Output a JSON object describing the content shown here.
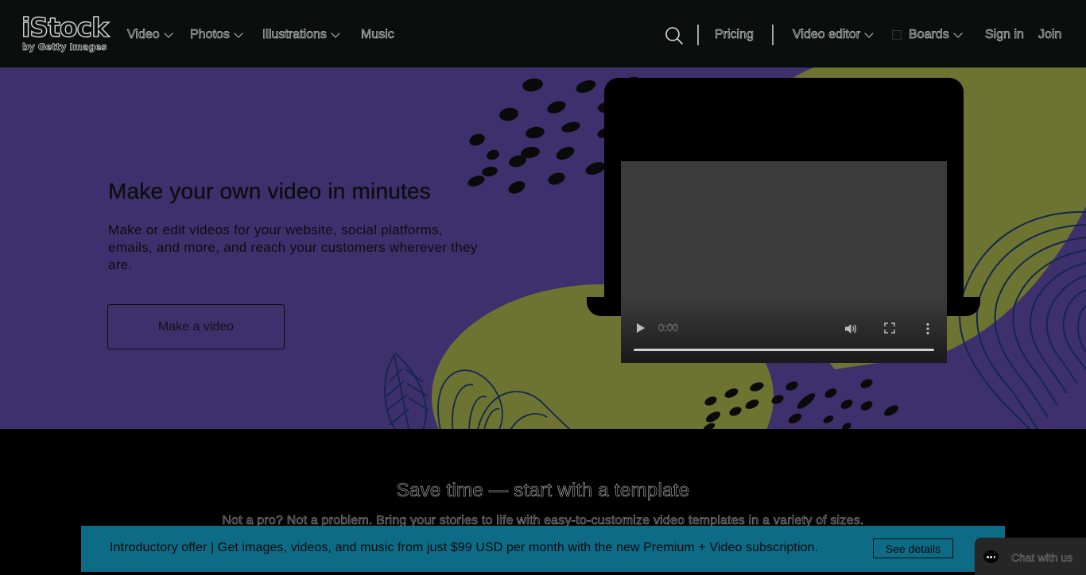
{
  "brand": {
    "name": "iStock",
    "tagline": "by Getty Images"
  },
  "nav": {
    "left_items": [
      {
        "label": "Video",
        "has_dropdown": true
      },
      {
        "label": "Photos",
        "has_dropdown": true
      },
      {
        "label": "Illustrations",
        "has_dropdown": true
      },
      {
        "label": "Music",
        "has_dropdown": false
      }
    ],
    "search_icon": "search-icon",
    "pricing": "Pricing",
    "video_editor": "Video editor",
    "boards": "Boards",
    "sign_in": "Sign in",
    "join": "Join"
  },
  "hero": {
    "title": "Make your own video in minutes",
    "subtitle": "Make or edit videos for your website, social platforms, emails, and more, and reach your customers wherever they are.",
    "cta": "Make a video",
    "video": {
      "time": "0:00",
      "progress": 0
    },
    "colors": {
      "background": "#3e306d",
      "accent_olive": "#6d7432",
      "line_art": "#13264f"
    }
  },
  "templates_section": {
    "title": "Save time — start with a template",
    "subtitle": "Not a pro? Not a problem. Bring your stories to life with easy-to-customize video templates in a variety of sizes."
  },
  "promo_banner": {
    "text": "Introductory offer | Get images, videos, and music from just $99 USD per month with the new Premium + Video subscription.",
    "button": "See details",
    "color": "#0d6b86"
  },
  "chat": {
    "label": "Chat with us",
    "icon": "chat-bubble-icon"
  }
}
